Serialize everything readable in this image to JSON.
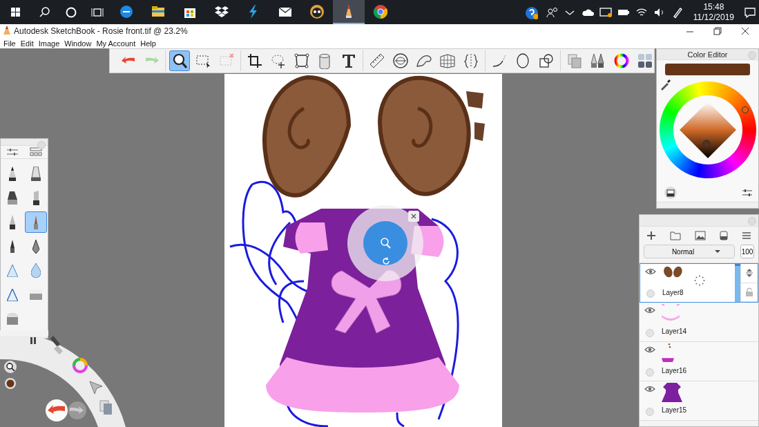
{
  "taskbar": {
    "apps": [
      {
        "kind": "edge",
        "selected": false
      },
      {
        "kind": "folder",
        "selected": false
      },
      {
        "kind": "store",
        "selected": false
      },
      {
        "kind": "dropbox",
        "selected": false
      },
      {
        "kind": "bolt",
        "selected": false
      },
      {
        "kind": "mail",
        "selected": false
      },
      {
        "kind": "cartoon",
        "selected": false
      },
      {
        "kind": "pencil",
        "selected": true
      },
      {
        "kind": "chrome",
        "selected": false
      }
    ],
    "time": "15:48",
    "date": "11/12/2019"
  },
  "window": {
    "title": "Autodesk SketchBook - Rosie front.tif @ 23.2%"
  },
  "menu": [
    "File",
    "Edit",
    "Image",
    "Window",
    "My Account",
    "Help"
  ],
  "toolbar": {
    "groups": [
      {
        "tools": [
          {
            "kind": "undo",
            "selected": false
          },
          {
            "kind": "redo",
            "selected": false
          }
        ]
      },
      {
        "tools": [
          {
            "kind": "zoom",
            "selected": true
          },
          {
            "kind": "select",
            "selected": false
          },
          {
            "kind": "deselect",
            "selected": false
          }
        ]
      },
      {
        "tools": [
          {
            "kind": "crop",
            "selected": false
          },
          {
            "kind": "lasso",
            "selected": false
          },
          {
            "kind": "transform",
            "selected": false
          },
          {
            "kind": "fill",
            "selected": false
          },
          {
            "kind": "text",
            "selected": false
          }
        ]
      },
      {
        "tools": [
          {
            "kind": "ruler",
            "selected": false
          },
          {
            "kind": "ellipse-guide",
            "selected": false
          },
          {
            "kind": "curve",
            "selected": false
          },
          {
            "kind": "perspective",
            "selected": false
          },
          {
            "kind": "symmetry",
            "selected": false
          }
        ]
      },
      {
        "tools": [
          {
            "kind": "line",
            "selected": false
          },
          {
            "kind": "ellipse",
            "selected": false
          },
          {
            "kind": "shapes",
            "selected": false
          }
        ]
      },
      {
        "tools": [
          {
            "kind": "copies",
            "selected": false
          },
          {
            "kind": "brushes",
            "selected": false
          },
          {
            "kind": "wheel",
            "selected": false
          },
          {
            "kind": "grid",
            "selected": false
          }
        ]
      }
    ]
  },
  "color_editor": {
    "title": "Color Editor"
  },
  "brushes": [
    {
      "selected": false
    },
    {
      "selected": false
    },
    {
      "selected": false
    },
    {
      "selected": false
    },
    {
      "selected": false
    },
    {
      "selected": true
    },
    {
      "selected": false
    },
    {
      "selected": false
    },
    {
      "selected": false
    },
    {
      "selected": false
    },
    {
      "selected": false
    },
    {
      "selected": false
    },
    {
      "selected": false
    }
  ],
  "layers": {
    "blend_mode": "Normal",
    "opacity": "100",
    "items": [
      {
        "name": "Layer8",
        "kind": "ears",
        "selected": true
      },
      {
        "name": "Layer14",
        "kind": "trim",
        "selected": false
      },
      {
        "name": "Layer16",
        "kind": "bow",
        "selected": false
      },
      {
        "name": "Layer15",
        "kind": "dress",
        "selected": false
      }
    ]
  }
}
